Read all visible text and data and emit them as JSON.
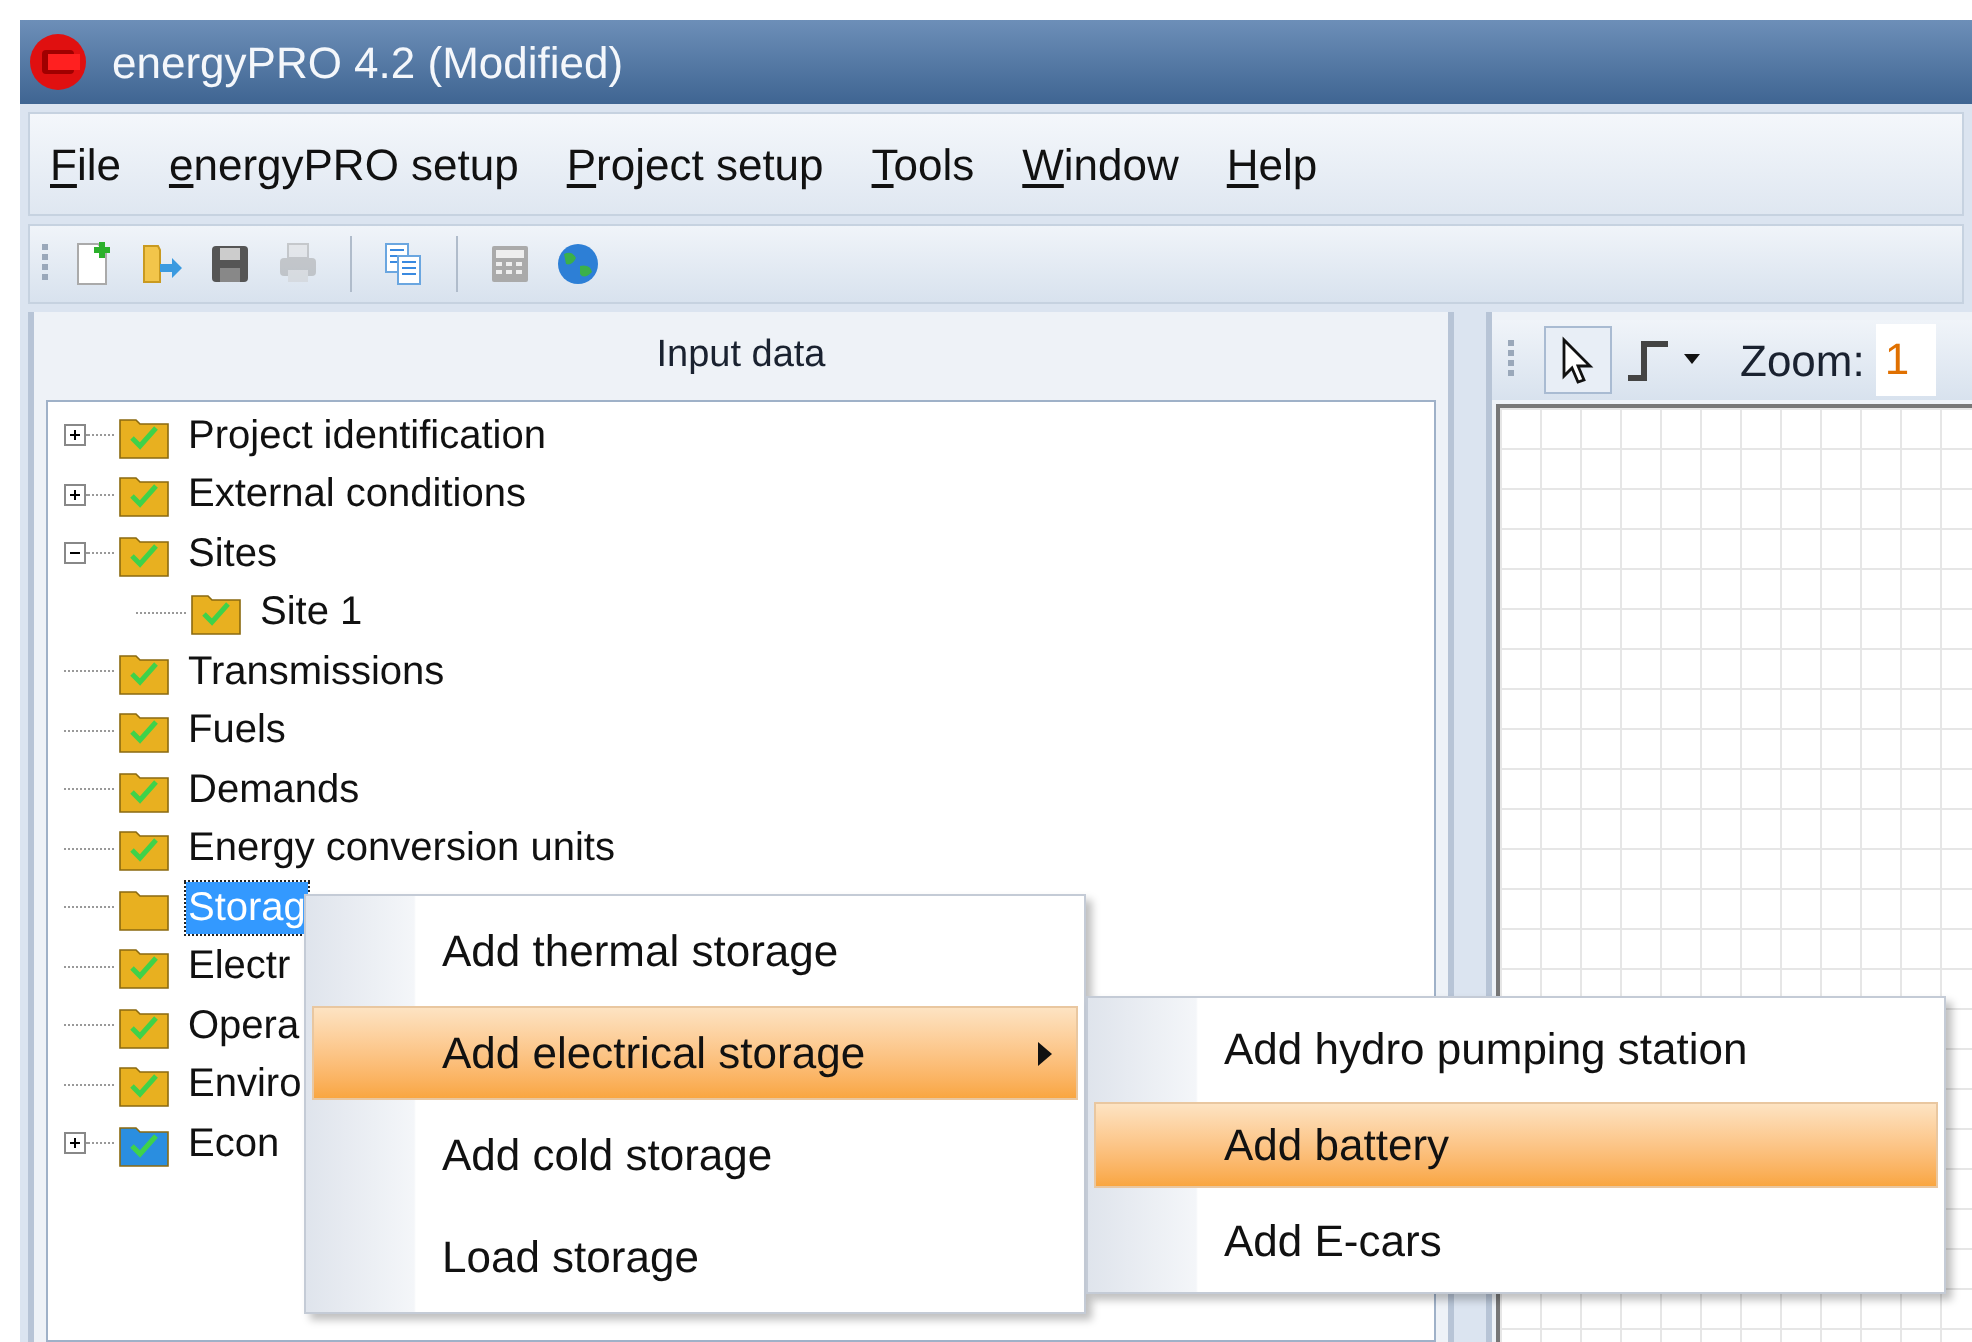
{
  "window": {
    "title": "energyPRO 4.2 (Modified)"
  },
  "menu": [
    {
      "accel": "F",
      "rest": "ile"
    },
    {
      "accel": "e",
      "rest": "nergyPRO setup"
    },
    {
      "accel": "P",
      "rest": "roject setup"
    },
    {
      "accel": "T",
      "rest": "ools"
    },
    {
      "accel": "W",
      "rest": "indow"
    },
    {
      "accel": "H",
      "rest": "elp"
    }
  ],
  "toolbar": [
    {
      "kind": "new",
      "disabled": false
    },
    {
      "kind": "open",
      "disabled": false
    },
    {
      "kind": "save",
      "disabled": false
    },
    {
      "kind": "print",
      "disabled": true
    },
    {
      "kind": "sep"
    },
    {
      "kind": "copy",
      "disabled": false
    },
    {
      "kind": "sep"
    },
    {
      "kind": "calculator",
      "disabled": false
    },
    {
      "kind": "globe",
      "disabled": false
    }
  ],
  "input_panel": {
    "title": "Input data",
    "tree": [
      {
        "label": "Project identification",
        "kind": "collapsed",
        "checked": true,
        "color": "#e8b020",
        "selected": false
      },
      {
        "label": "External conditions",
        "kind": "collapsed",
        "checked": true,
        "color": "#e8b020",
        "selected": false
      },
      {
        "label": "Sites",
        "kind": "expanded",
        "checked": true,
        "color": "#e8b020",
        "selected": false,
        "children": [
          {
            "label": "Site 1",
            "checked": true,
            "color": "#e8b020",
            "selected": false
          }
        ]
      },
      {
        "label": "Transmissions",
        "kind": "leaf",
        "checked": true,
        "color": "#e8b020",
        "selected": false
      },
      {
        "label": "Fuels",
        "kind": "leaf",
        "checked": true,
        "color": "#e8b020",
        "selected": false
      },
      {
        "label": "Demands",
        "kind": "leaf",
        "checked": true,
        "color": "#e8b020",
        "selected": false
      },
      {
        "label": "Energy conversion units",
        "kind": "leaf",
        "checked": true,
        "color": "#e8b020",
        "selected": false
      },
      {
        "label": "Storag",
        "kind": "leaf",
        "checked": false,
        "color": "#e8b020",
        "selected": true
      },
      {
        "label": "Electr",
        "kind": "leaf",
        "checked": true,
        "color": "#e8b020",
        "selected": false
      },
      {
        "label": "Opera",
        "kind": "leaf",
        "checked": true,
        "color": "#e8b020",
        "selected": false
      },
      {
        "label": "Enviro",
        "kind": "leaf",
        "checked": true,
        "color": "#e8b020",
        "selected": false
      },
      {
        "label": "Econ",
        "kind": "collapsed",
        "checked": true,
        "color": "#2a8ee0",
        "selected": false
      }
    ]
  },
  "diagram_panel": {
    "zoom_label": "Zoom:",
    "zoom_value": "1"
  },
  "context_menu": [
    {
      "label": "Add thermal storage",
      "selected": false,
      "submenu": false
    },
    {
      "label": "Add electrical storage",
      "selected": true,
      "submenu": true
    },
    {
      "label": "Add cold storage",
      "selected": false,
      "submenu": false
    },
    {
      "label": "Load storage",
      "selected": false,
      "submenu": false
    }
  ],
  "submenu": [
    {
      "label": "Add hydro pumping station",
      "selected": false
    },
    {
      "label": "Add battery",
      "selected": true
    },
    {
      "label": "Add E-cars",
      "selected": false
    }
  ]
}
